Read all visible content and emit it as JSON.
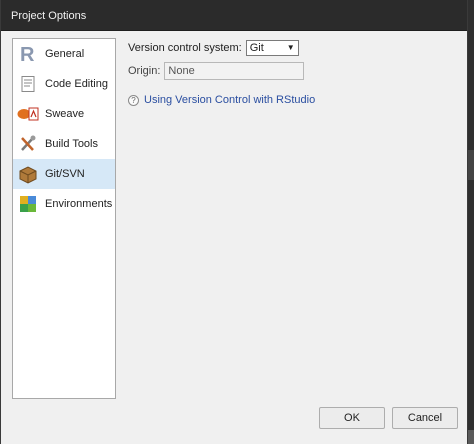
{
  "window": {
    "title": "Project Options"
  },
  "sidebar": {
    "items": [
      {
        "label": "General",
        "icon": "r-logo-icon"
      },
      {
        "label": "Code Editing",
        "icon": "code-editing-icon"
      },
      {
        "label": "Sweave",
        "icon": "sweave-icon"
      },
      {
        "label": "Build Tools",
        "icon": "build-tools-icon"
      },
      {
        "label": "Git/SVN",
        "icon": "git-svn-icon",
        "selected": true
      },
      {
        "label": "Environments",
        "icon": "environments-icon"
      }
    ]
  },
  "main": {
    "vcs_label": "Version control system:",
    "vcs_value": "Git",
    "origin_label": "Origin:",
    "origin_value": "None",
    "help_link": "Using Version Control with RStudio"
  },
  "buttons": {
    "ok": "OK",
    "cancel": "Cancel"
  },
  "colors": {
    "selected_bg": "#d6e8f7",
    "link": "#2a4ea0",
    "titlebar": "#2b2b2b"
  }
}
